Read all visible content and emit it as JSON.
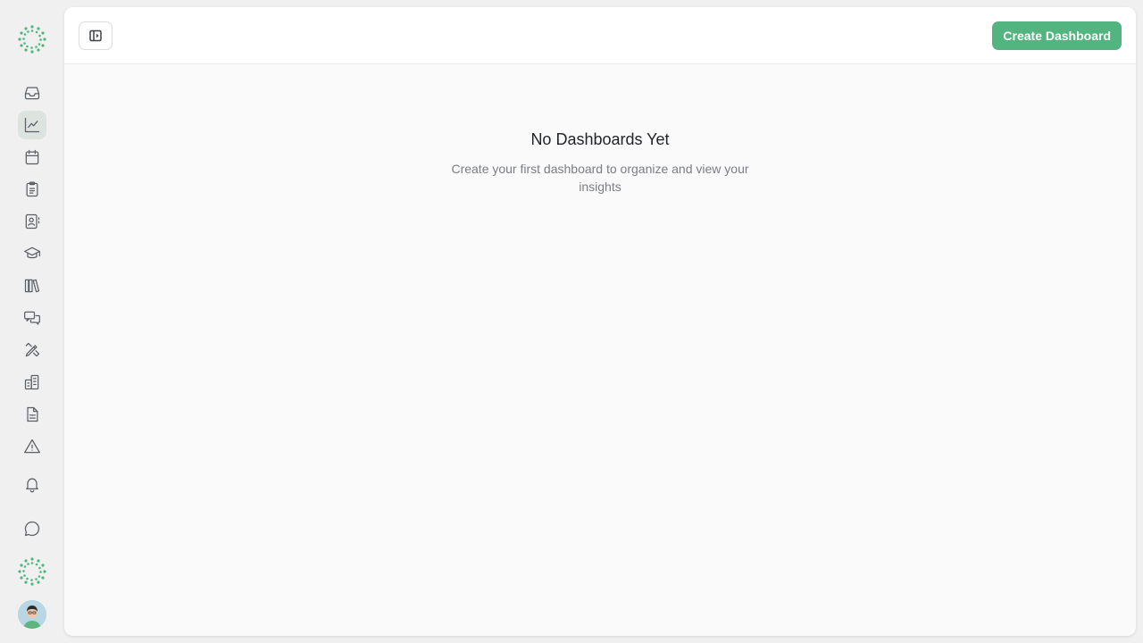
{
  "header": {
    "create_button_label": "Create Dashboard"
  },
  "empty_state": {
    "title": "No Dashboards Yet",
    "description": "Create your first dashboard to organize and view your insights"
  },
  "sidebar": {
    "items": [
      {
        "icon": "inbox-icon"
      },
      {
        "icon": "chart-line-icon",
        "active": true
      },
      {
        "icon": "calendar-icon"
      },
      {
        "icon": "clipboard-icon"
      },
      {
        "icon": "contact-book-icon"
      },
      {
        "icon": "graduation-cap-icon"
      },
      {
        "icon": "library-icon"
      },
      {
        "icon": "messages-icon"
      },
      {
        "icon": "pencil-ruler-icon"
      },
      {
        "icon": "buildings-icon"
      },
      {
        "icon": "document-icon"
      },
      {
        "icon": "warning-icon"
      },
      {
        "icon": "bell-icon"
      },
      {
        "icon": "chat-bubble-icon"
      }
    ]
  },
  "colors": {
    "accent": "#52b47e",
    "active_item_bg": "#dde3df"
  }
}
